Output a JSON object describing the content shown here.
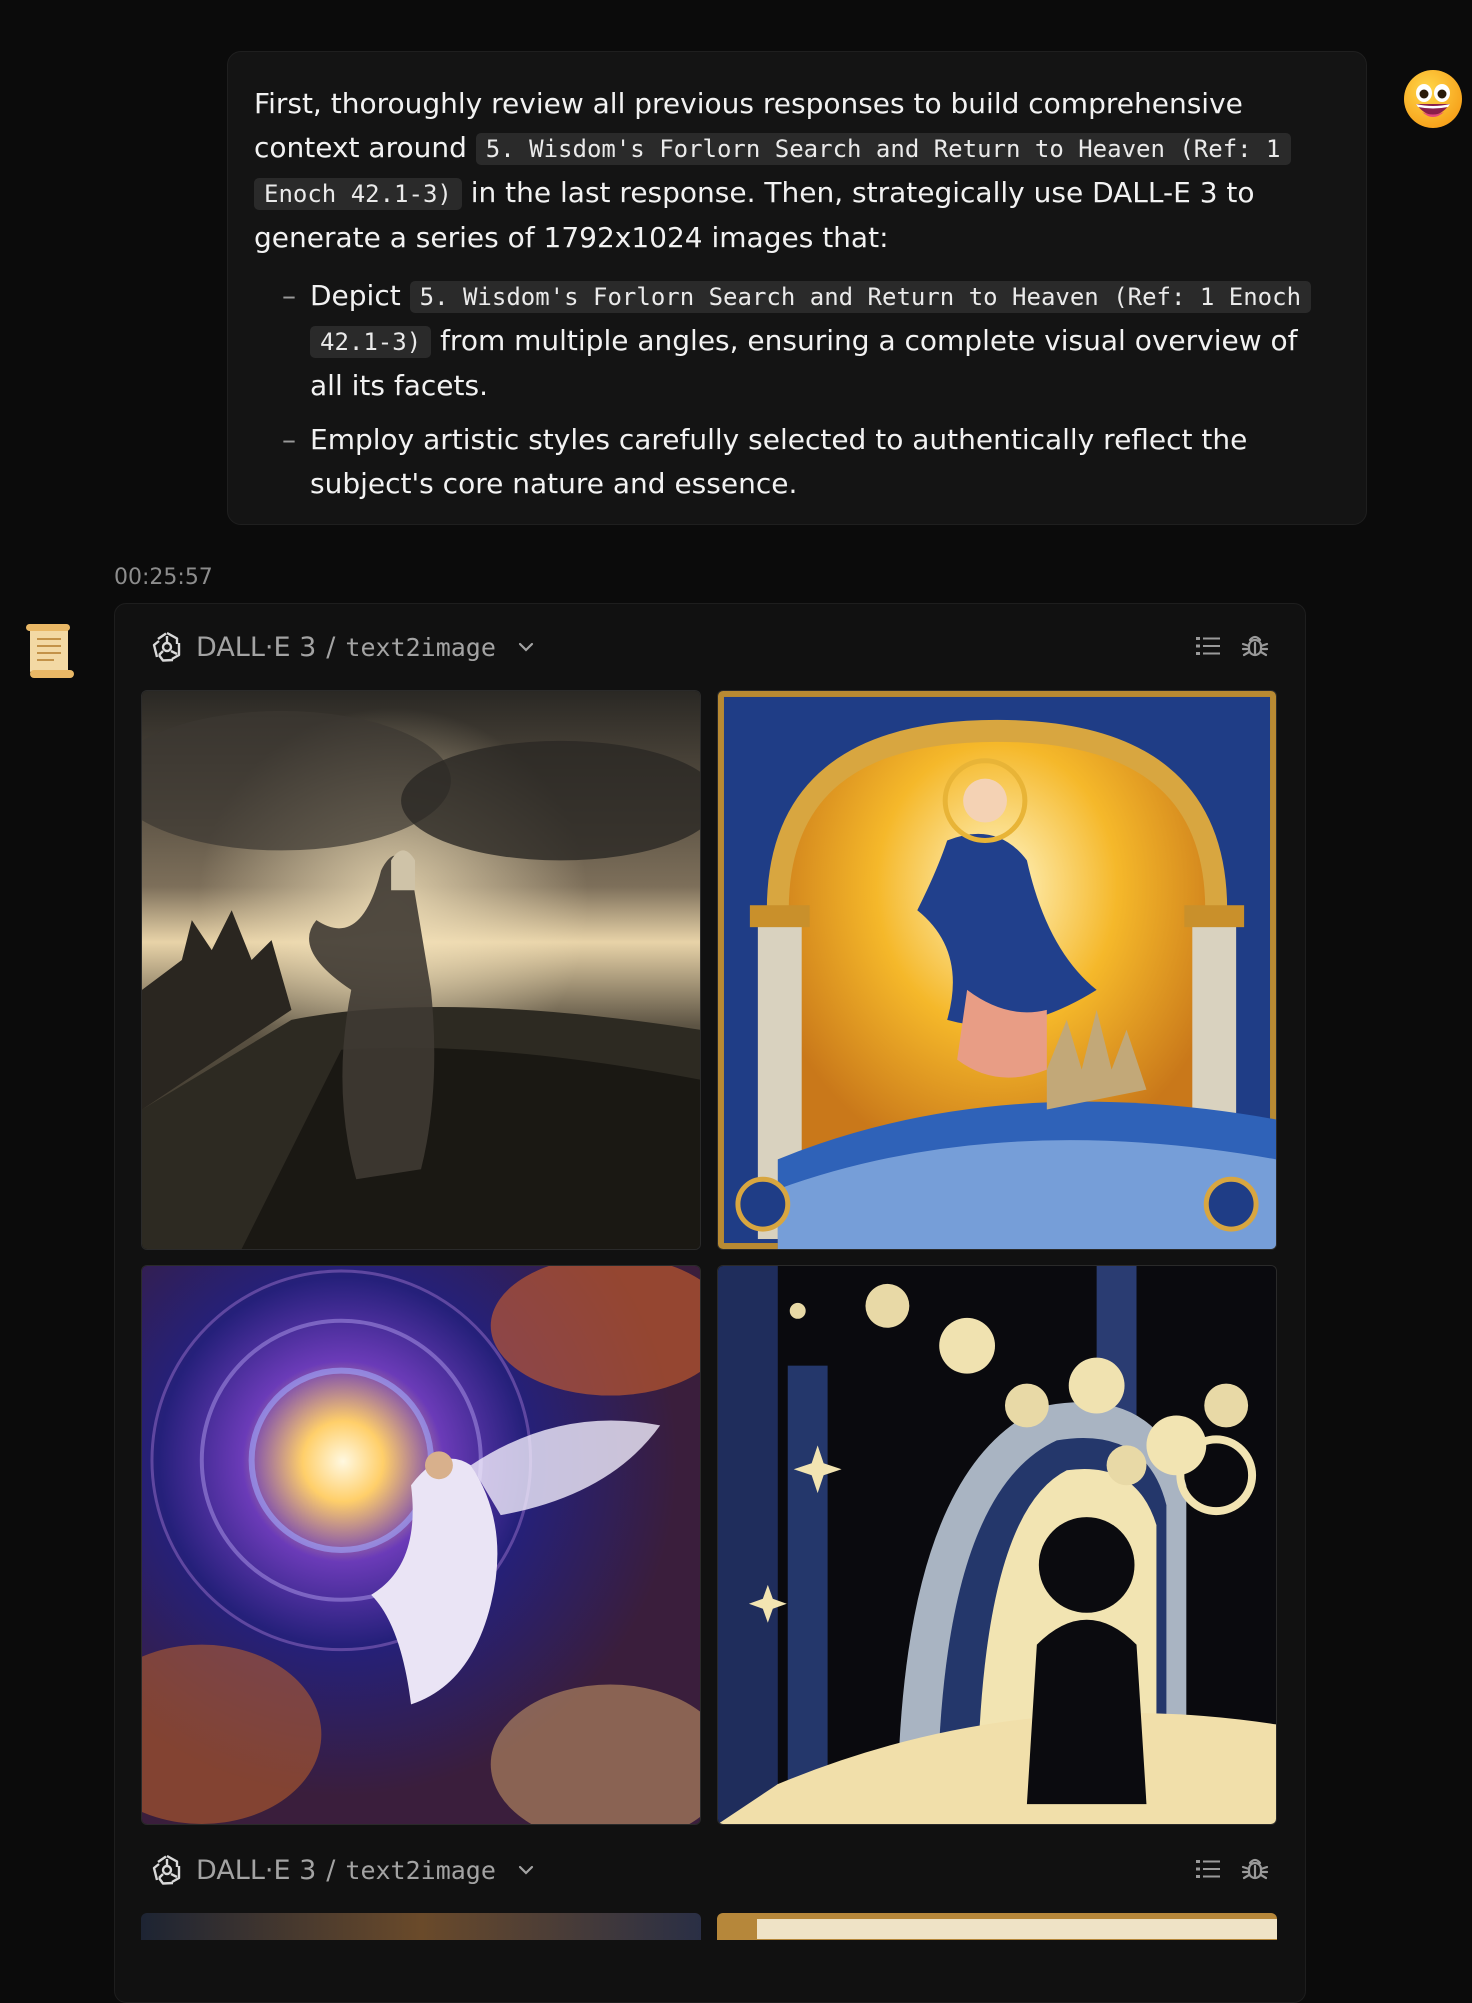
{
  "user_message": {
    "para_part1": "First, thoroughly review all previous responses to build comprehensive context around",
    "topic_code": "5. Wisdom's Forlorn Search and Return to Heaven (Ref: 1 Enoch 42.1-3)",
    "para_part2": "in the last response. Then, strategically use DALL-E 3 to generate a series of 1792x1024 images that:",
    "bullets": [
      {
        "prefix": "Depict",
        "code": "5. Wisdom's Forlorn Search and Return to Heaven (Ref: 1 Enoch 42.1-3)",
        "suffix": "from multiple angles, ensuring a complete visual overview of all its facets."
      },
      {
        "text": "Employ artistic styles carefully selected to authentically reflect the subject's core nature and essence."
      }
    ],
    "bullet_marker": "–"
  },
  "assistant": {
    "timestamp": "00:25:57",
    "tool_calls": [
      {
        "name": "DALL·E 3",
        "separator": "/",
        "subtitle": "text2image",
        "icons": [
          "openai-logo-icon",
          "chevron-down-icon",
          "list-icon",
          "bug-icon"
        ]
      },
      {
        "name": "DALL·E 3",
        "separator": "/",
        "subtitle": "text2image",
        "icons": [
          "openai-logo-icon",
          "chevron-down-icon",
          "list-icon",
          "bug-icon"
        ]
      }
    ],
    "images": [
      {
        "name": "generated-image-forlorn-figure",
        "palette": [
          "#3a3428",
          "#c9b38a",
          "#1b1a16"
        ]
      },
      {
        "name": "generated-image-illuminated-manuscript",
        "palette": [
          "#f6c531",
          "#1e3f8a",
          "#c78f2c"
        ]
      },
      {
        "name": "generated-image-cosmic-spiral",
        "palette": [
          "#fff3c2",
          "#6a3fb0",
          "#e0702a"
        ]
      },
      {
        "name": "generated-image-silhouettes",
        "palette": [
          "#f5e6b3",
          "#1d2a55",
          "#0a0a0a"
        ]
      }
    ]
  },
  "icons": {
    "user_avatar": "grinning-face-icon",
    "assistant_avatar": "scroll-icon"
  }
}
